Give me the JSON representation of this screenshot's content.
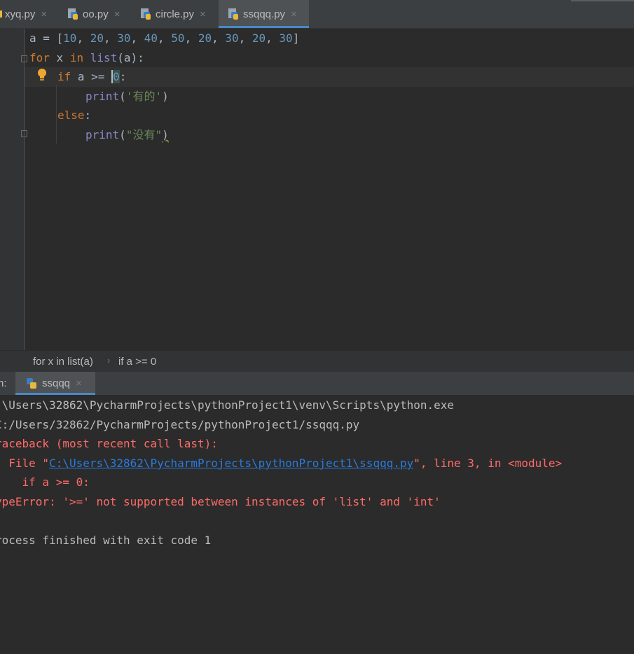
{
  "tabs": [
    {
      "label": "xyq.py",
      "active": false
    },
    {
      "label": "oo.py",
      "active": false
    },
    {
      "label": "circle.py",
      "active": false
    },
    {
      "label": "ssqqq.py",
      "active": true
    }
  ],
  "tab_close_symbol": "×",
  "editor": {
    "line1": {
      "var": "a",
      "op": " = [",
      "nums": [
        "10",
        "20",
        "30",
        "40",
        "50",
        "20",
        "30",
        "20",
        "30"
      ],
      "end": "]"
    },
    "line2": {
      "kw_for": "for",
      "x": " x ",
      "kw_in": "in",
      "sp": " ",
      "fn": "list",
      "args": "(a):"
    },
    "line3": {
      "kw_if": "if",
      "mid": " a >= ",
      "num": "0",
      "end": ":"
    },
    "line4": {
      "fn": "print",
      "open": "(",
      "str": "'有的'",
      "close": ")"
    },
    "line5": {
      "kw_else": "else",
      "end": ":"
    },
    "line6": {
      "fn": "print",
      "open": "(",
      "str": "\"没有\"",
      "close": ")"
    }
  },
  "breadcrumb": {
    "item1": "for x in list(a)",
    "sep": "›",
    "item2": "if a >= 0"
  },
  "run": {
    "label_prefix": "n:",
    "tab_label": "ssqqq",
    "close_symbol": "×"
  },
  "console": {
    "line1": ":\\Users\\32862\\PycharmProjects\\pythonProject1\\venv\\Scripts\\python.exe",
    "line2": "C:/Users/32862/PycharmProjects/pythonProject1/ssqqq.py",
    "line3": "raceback (most recent call last):",
    "line4_pre": "  File \"",
    "line4_link": "C:\\Users\\32862\\PycharmProjects\\pythonProject1\\ssqqq.py",
    "line4_post": "\", line 3, in <module>",
    "line5": "    if a >= 0:",
    "line6": "ypeError: '>=' not supported between instances of 'list' and 'int'",
    "line7": "rocess finished with exit code 1"
  },
  "colors": {
    "background": "#2b2b2b",
    "keyword": "#cc7832",
    "number": "#6897bb",
    "string": "#6a8759",
    "builtin": "#8888c6",
    "error": "#ff6b68",
    "link": "#287bde",
    "accent": "#4a88c7"
  },
  "icons": {
    "tab_icon": "python-file-icon",
    "bulb": "lightbulb-icon",
    "run_icon": "python-icon"
  }
}
